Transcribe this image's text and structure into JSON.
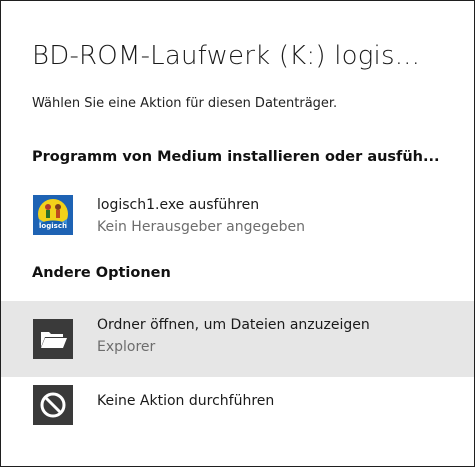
{
  "dialog": {
    "title": "BD-ROM-Laufwerk (K:) logis...",
    "subtitle": "Wählen Sie eine Aktion für diesen Datenträger."
  },
  "sections": {
    "install": {
      "heading": "Programm von Medium installieren oder ausfüh..."
    },
    "other": {
      "heading": "Andere Optionen"
    }
  },
  "items": [
    {
      "label": "logisch1.exe ausführen",
      "detail": "Kein Herausgeber angegeben",
      "icon": "logisch-app-icon",
      "highlighted": false
    },
    {
      "label": "Ordner öffnen, um Dateien anzuzeigen",
      "detail": "Explorer",
      "icon": "folder-open-icon",
      "highlighted": true
    },
    {
      "label": "Keine Aktion durchführen",
      "detail": "",
      "icon": "no-action-icon",
      "highlighted": false
    }
  ],
  "colors": {
    "highlight": "#e6e6e6",
    "icon_tile": "#3a3a3a",
    "secondary_text": "#6d6d6d"
  }
}
